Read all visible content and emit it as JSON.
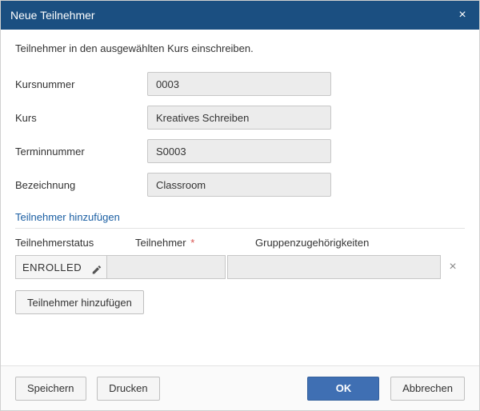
{
  "dialog": {
    "title": "Neue Teilnehmer",
    "intro": "Teilnehmer in den ausgewählten Kurs einschreiben."
  },
  "fields": {
    "course_number_label": "Kursnummer",
    "course_number_value": "0003",
    "course_label": "Kurs",
    "course_value": "Kreatives Schreiben",
    "session_number_label": "Terminnummer",
    "session_number_value": "S0003",
    "designation_label": "Bezeichnung",
    "designation_value": "Classroom"
  },
  "section": {
    "title": "Teilnehmer hinzufügen",
    "col_status": "Teilnehmerstatus",
    "col_participant": "Teilnehmer",
    "col_participant_required": "*",
    "col_groups": "Gruppenzugehörigkeiten",
    "rows": [
      {
        "status": "ENROLLED",
        "participant": "",
        "groups": ""
      }
    ],
    "add_button": "Teilnehmer hinzufügen"
  },
  "footer": {
    "save": "Speichern",
    "print": "Drucken",
    "ok": "OK",
    "cancel": "Abbrechen"
  }
}
